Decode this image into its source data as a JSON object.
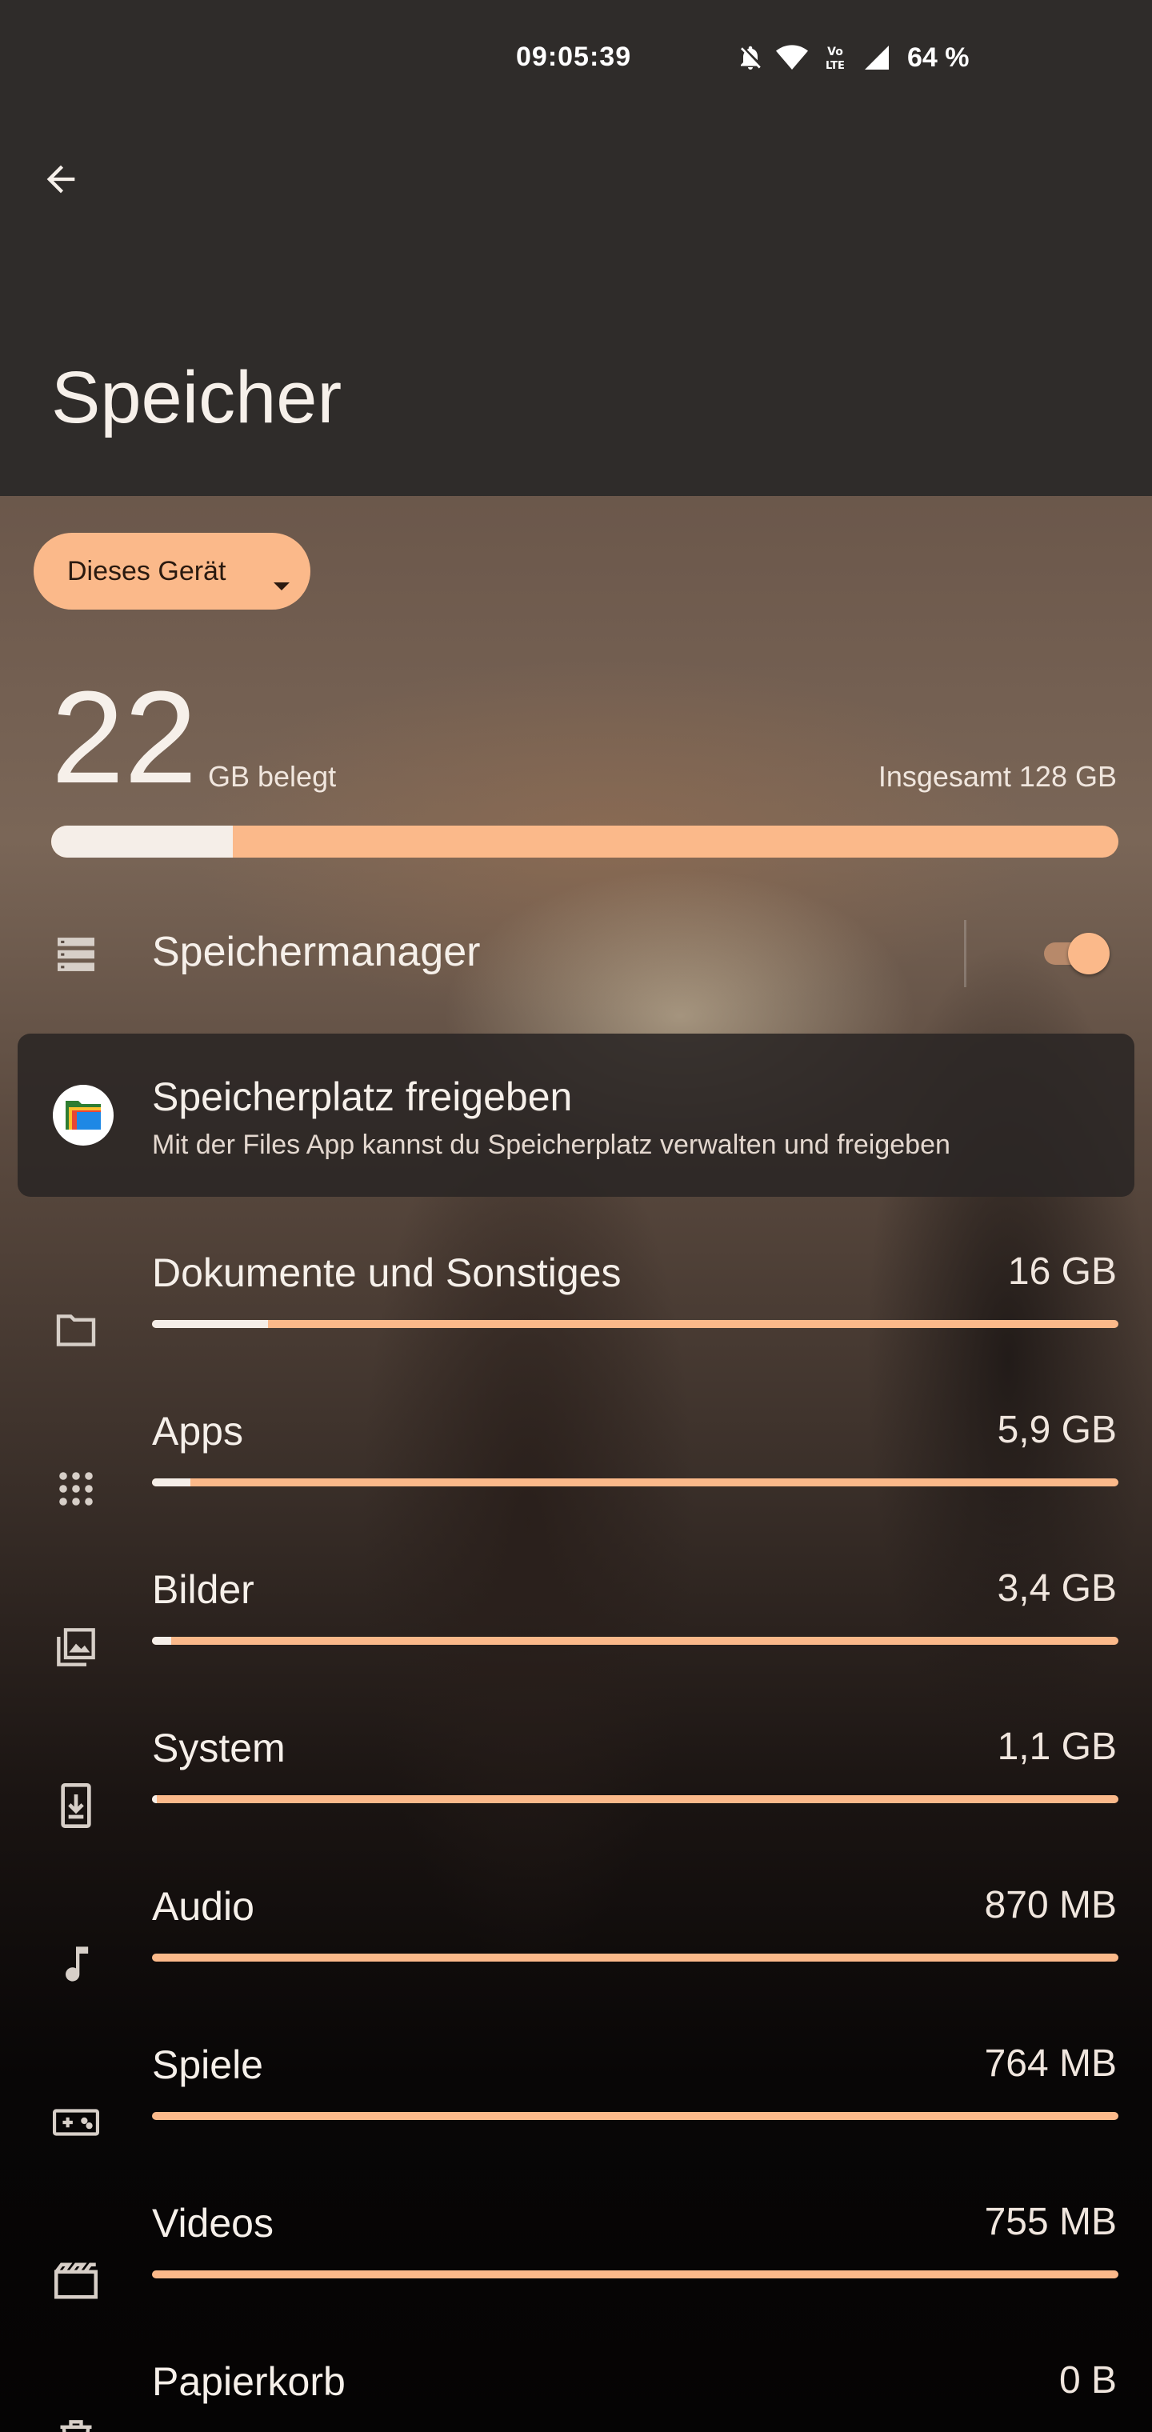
{
  "status_bar": {
    "time": "09:05:39",
    "battery": "64 %",
    "icons": [
      "bell-off-icon",
      "wifi-icon",
      "volte-icon",
      "signal-icon"
    ]
  },
  "header": {
    "back_icon": "arrow-back-icon",
    "title": "Speicher"
  },
  "device_selector": {
    "label": "Dieses Gerät",
    "icon": "caret-down-icon"
  },
  "summary": {
    "used_value": "22",
    "used_unit": "GB belegt",
    "total": "Insgesamt 128 GB",
    "used_fraction": 0.17
  },
  "storage_manager": {
    "label": "Speichermanager",
    "icon": "storage-list-icon",
    "enabled": true
  },
  "free_space_card": {
    "title": "Speicherplatz freigeben",
    "subtitle": "Mit der Files App kannst du Speicherplatz verwalten und freigeben",
    "icon": "files-app-icon"
  },
  "categories": [
    {
      "label": "Dokumente und Sonstiges",
      "value": "16 GB",
      "fraction": 0.12,
      "icon": "folder-icon"
    },
    {
      "label": "Apps",
      "value": "5,9 GB",
      "fraction": 0.04,
      "icon": "apps-grid-icon"
    },
    {
      "label": "Bilder",
      "value": "3,4 GB",
      "fraction": 0.02,
      "icon": "images-icon"
    },
    {
      "label": "System",
      "value": "1,1 GB",
      "fraction": 0.005,
      "icon": "system-update-icon"
    },
    {
      "label": "Audio",
      "value": "870 MB",
      "fraction": 0.0,
      "icon": "music-note-icon"
    },
    {
      "label": "Spiele",
      "value": "764 MB",
      "fraction": 0.0,
      "icon": "gamepad-icon"
    },
    {
      "label": "Videos",
      "value": "755 MB",
      "fraction": 0.0,
      "icon": "movie-icon"
    },
    {
      "label": "Papierkorb",
      "value": "0 B",
      "fraction": 0.0,
      "icon": "trash-icon"
    }
  ],
  "colors": {
    "accent": "#fbb98a",
    "bar_used": "#f5eee8",
    "header_bg": "#2f2c2a"
  }
}
